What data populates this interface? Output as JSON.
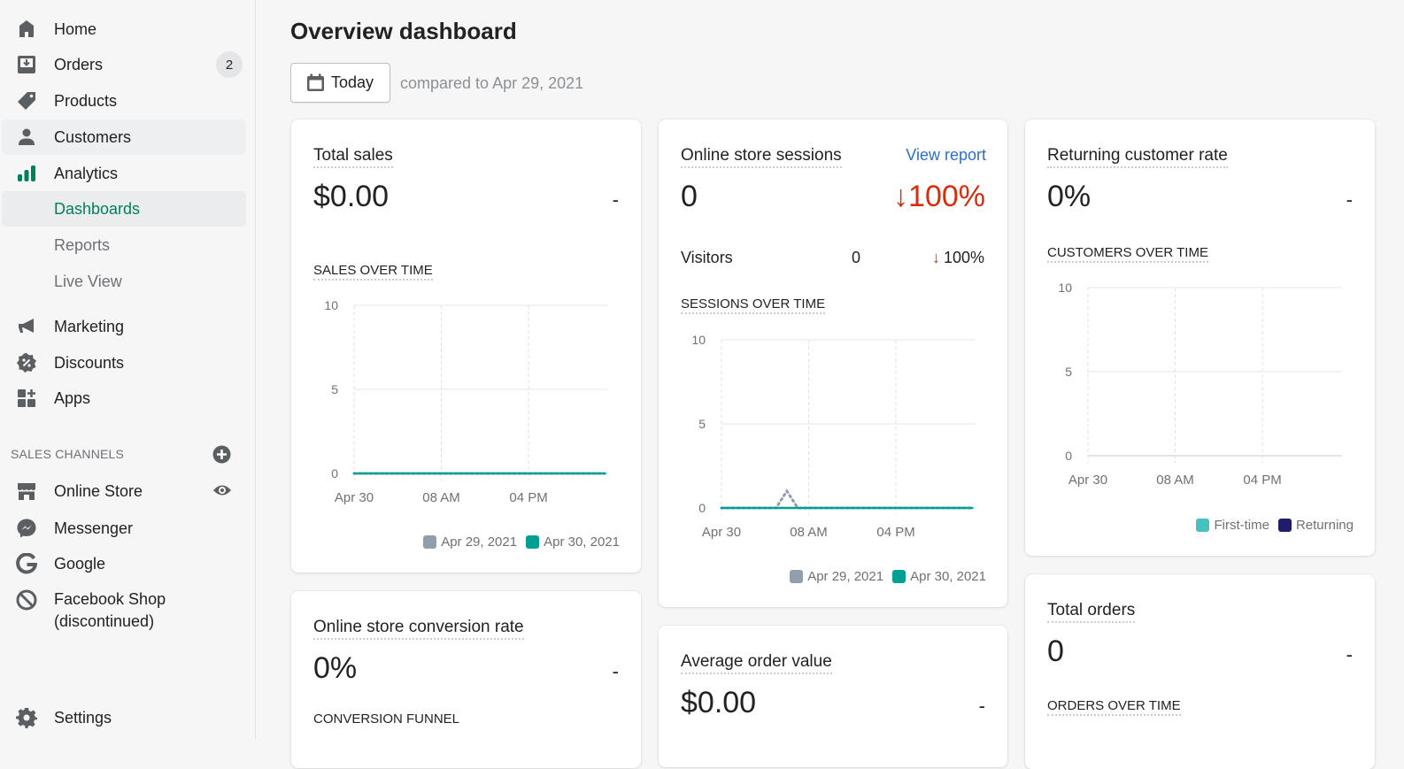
{
  "sidebar": {
    "items": [
      {
        "label": "Home",
        "icon": "home-icon"
      },
      {
        "label": "Orders",
        "icon": "orders-icon",
        "badge": "2"
      },
      {
        "label": "Products",
        "icon": "tag-icon"
      },
      {
        "label": "Customers",
        "icon": "customer-icon"
      },
      {
        "label": "Analytics",
        "icon": "analytics-icon"
      }
    ],
    "analytics_sub": [
      {
        "label": "Dashboards",
        "selected": true
      },
      {
        "label": "Reports"
      },
      {
        "label": "Live View"
      }
    ],
    "items2": [
      {
        "label": "Marketing",
        "icon": "megaphone-icon"
      },
      {
        "label": "Discounts",
        "icon": "discount-icon"
      },
      {
        "label": "Apps",
        "icon": "apps-icon"
      }
    ],
    "sales_channels_heading": "SALES CHANNELS",
    "channels": [
      {
        "label": "Online Store",
        "icon": "store-icon"
      },
      {
        "label": "Messenger",
        "icon": "messenger-icon"
      },
      {
        "label": "Google",
        "icon": "google-icon"
      },
      {
        "label": "Facebook Shop",
        "label2": "(discontinued)",
        "icon": "disabled-icon"
      }
    ],
    "settings": {
      "label": "Settings",
      "icon": "gear-icon"
    }
  },
  "header": {
    "title": "Overview dashboard",
    "date_button": "Today",
    "compare_text": "compared to Apr 29, 2021"
  },
  "colors": {
    "accent": "#007f5f",
    "teal": "#47c1bf",
    "current_series": "#009f93",
    "previous_series": "#919eab",
    "returning": "#1f1d6b",
    "negative": "#d72c0d",
    "link": "#2c6ecb"
  },
  "cards": {
    "total_sales": {
      "title": "Total sales",
      "value": "$0.00",
      "change": "-",
      "chart_title": "SALES OVER TIME",
      "legend": [
        "Apr 29, 2021",
        "Apr 30, 2021"
      ]
    },
    "sessions": {
      "title": "Online store sessions",
      "link": "View report",
      "value": "0",
      "change": "↓100%",
      "visitors_label": "Visitors",
      "visitors_value": "0",
      "visitors_change_arrow": "↓",
      "visitors_change": "100%",
      "chart_title": "SESSIONS OVER TIME",
      "legend": [
        "Apr 29, 2021",
        "Apr 30, 2021"
      ]
    },
    "returning": {
      "title": "Returning customer rate",
      "value": "0%",
      "change": "-",
      "chart_title": "CUSTOMERS OVER TIME",
      "legend": [
        "First-time",
        "Returning"
      ]
    },
    "conversion": {
      "title": "Online store conversion rate",
      "value": "0%",
      "change": "-",
      "chart_title": "CONVERSION FUNNEL"
    },
    "aov": {
      "title": "Average order value",
      "value": "$0.00",
      "change": "-"
    },
    "orders": {
      "title": "Total orders",
      "value": "0",
      "change": "-",
      "chart_title": "ORDERS OVER TIME"
    }
  },
  "chart_data": [
    {
      "type": "line",
      "title": "SALES OVER TIME",
      "x_ticks": [
        "Apr 30",
        "08 AM",
        "04 PM"
      ],
      "x_hours": [
        0,
        1,
        2,
        3,
        4,
        5,
        6,
        7,
        8,
        9,
        10,
        11,
        12,
        13,
        14,
        15,
        16,
        17,
        18,
        19,
        20,
        21,
        22,
        23
      ],
      "y_ticks": [
        "0",
        "5",
        "10"
      ],
      "ylim": [
        0,
        10
      ],
      "series": [
        {
          "name": "Apr 29, 2021",
          "color": "#919eab",
          "style": "dotted",
          "values": [
            0,
            0,
            0,
            0,
            0,
            0,
            0,
            0,
            0,
            0,
            0,
            0,
            0,
            0,
            0,
            0,
            0,
            0,
            0,
            0,
            0,
            0,
            0,
            0
          ]
        },
        {
          "name": "Apr 30, 2021",
          "color": "#009f93",
          "style": "solid",
          "values": [
            0,
            0,
            0,
            0,
            0,
            0,
            0,
            0,
            0,
            0,
            0,
            0,
            0,
            0,
            0,
            0,
            0,
            0,
            0,
            0,
            0,
            0,
            0,
            0
          ]
        }
      ],
      "legend": "bottom-right",
      "grid": true
    },
    {
      "type": "line",
      "title": "SESSIONS OVER TIME",
      "x_ticks": [
        "Apr 30",
        "08 AM",
        "04 PM"
      ],
      "x_hours": [
        0,
        1,
        2,
        3,
        4,
        5,
        6,
        7,
        8,
        9,
        10,
        11,
        12,
        13,
        14,
        15,
        16,
        17,
        18,
        19,
        20,
        21,
        22,
        23
      ],
      "y_ticks": [
        "0",
        "5",
        "10"
      ],
      "ylim": [
        0,
        10
      ],
      "series": [
        {
          "name": "Apr 29, 2021",
          "color": "#919eab",
          "style": "dotted",
          "values": [
            0,
            0,
            0,
            0,
            0,
            0,
            1,
            0,
            0,
            0,
            0,
            0,
            0,
            0,
            0,
            0,
            0,
            0,
            0,
            0,
            0,
            0,
            0,
            0
          ]
        },
        {
          "name": "Apr 30, 2021",
          "color": "#009f93",
          "style": "solid",
          "values": [
            0,
            0,
            0,
            0,
            0,
            0,
            0,
            0,
            0,
            0,
            0,
            0,
            0,
            0,
            0,
            0,
            0,
            0,
            0,
            0,
            0,
            0,
            0,
            0
          ]
        }
      ],
      "legend": "bottom-right",
      "grid": true
    },
    {
      "type": "bar",
      "title": "CUSTOMERS OVER TIME",
      "x_ticks": [
        "Apr 30",
        "08 AM",
        "04 PM"
      ],
      "y_ticks": [
        "0",
        "5",
        "10"
      ],
      "ylim": [
        0,
        10
      ],
      "series": [
        {
          "name": "First-time",
          "color": "#47c1bf",
          "values": []
        },
        {
          "name": "Returning",
          "color": "#1f1d6b",
          "values": []
        }
      ],
      "legend": "bottom-right",
      "grid": true
    }
  ]
}
